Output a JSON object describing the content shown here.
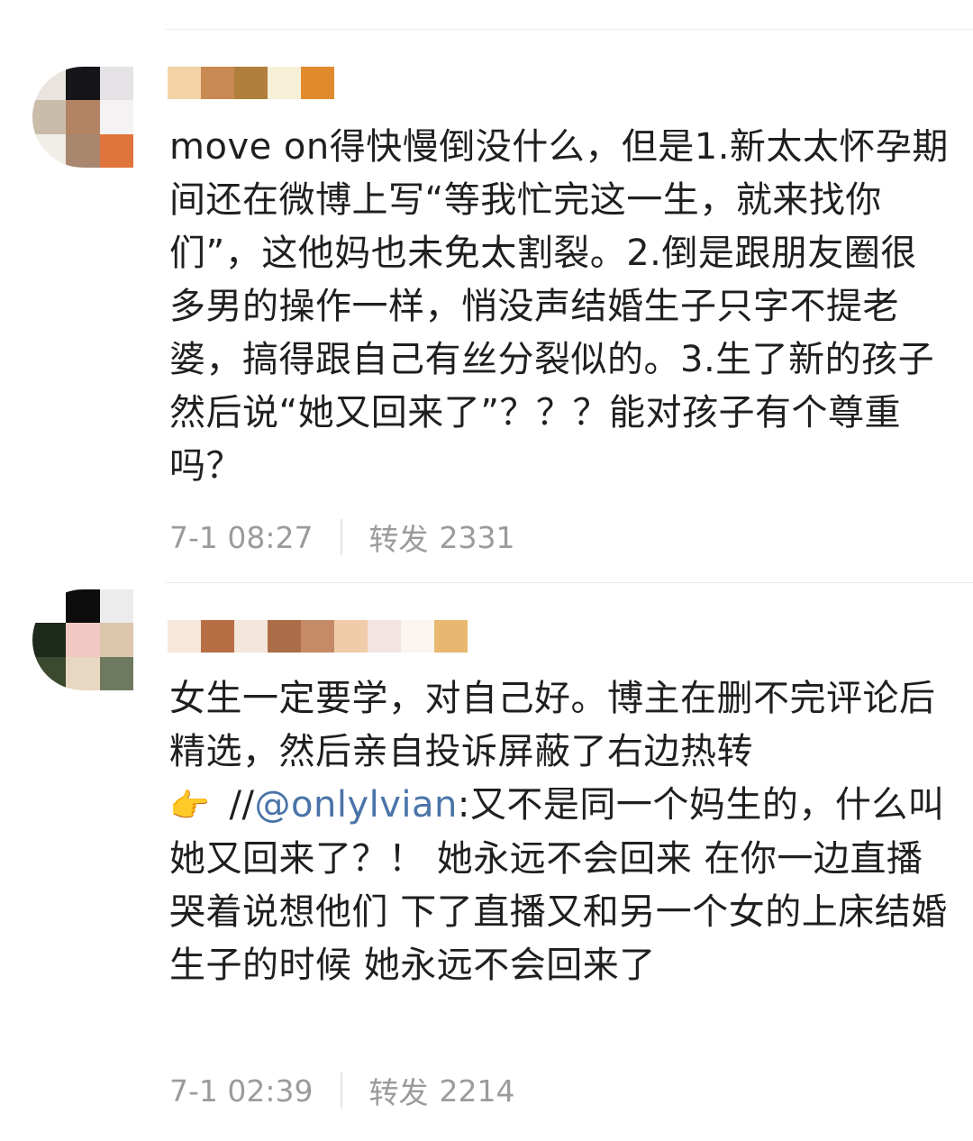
{
  "comments": [
    {
      "avatar_colors": [
        "#e9e4df",
        "#15151a",
        "#e6e3e6",
        "#c9bca9",
        "#b38463",
        "#f4f2f2",
        "#f1eee8",
        "#a9876f",
        "#e1733c"
      ],
      "username_colors": [
        "#f3d2a5",
        "#c98952",
        "#b07f3c",
        "#f6f0d8",
        "#e08a2e"
      ],
      "text": "move on得快慢倒没什么，但是1.新太太怀孕期间还在微博上写“等我忙完这一生，就来找你们”，这他妈也未免太割裂。2.倒是跟朋友圈很多男的操作一样，悄没声结婚生子只字不提老婆，搞得跟自己有丝分裂似的。3.生了新的孩子然后说“她又回来了”？？？能对孩子有个尊重吗？",
      "time": "7-1 08:27",
      "repost_label": "转发",
      "repost_count": "2331"
    },
    {
      "avatar_colors": [
        "#ffffff",
        "#0d0d0d",
        "#ececec",
        "#1e2a1c",
        "#f0c9c3",
        "#dcc7ad",
        "#3b4a2e",
        "#e9d8c1",
        "#6e7a60"
      ],
      "username_colors": [
        "#f6e7da",
        "#b86e45",
        "#f4e6da",
        "#ab6c48",
        "#c48b66",
        "#f0cca9",
        "#f3e4e2",
        "#faf6ef",
        "#e8b870"
      ],
      "text_before": "女生一定要学，对自己好。博主在删不完评论后精选，然后亲自投诉屏蔽了右边热转",
      "emoji": "👉",
      "slashes": " //",
      "mention": "@onlylvian",
      "text_after": ":又不是同一个妈生的，什么叫她又回来了？！ 她永远不会回来 在你一边直播哭着说想他们 下了直播又和另一个女的上床结婚生子的时候 她永远不会回来了",
      "time": "7-1 02:39",
      "repost_label": "转发",
      "repost_count": "2214"
    }
  ]
}
